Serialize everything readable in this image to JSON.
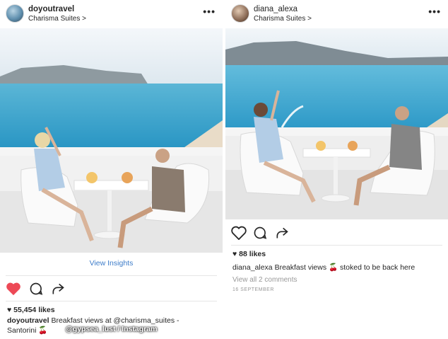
{
  "left_post": {
    "username": "doyoutravel",
    "location": "Charisma Suites",
    "location_chevron": ">",
    "more_icon": "•••",
    "insights_link": "View Insights",
    "likes": "55,454 likes",
    "caption_user": "doyoutravel",
    "caption_text": "Breakfast views at @charisma_suites -",
    "caption_line2": "Santorini 🍒",
    "liked": true,
    "like_color": "#ed4956"
  },
  "right_post": {
    "username": "diana_alexa",
    "location": "Charisma Suites",
    "location_chevron": ">",
    "more_icon": "•••",
    "likes": "88 likes",
    "caption_user": "diana_alexa",
    "caption_text": "Breakfast views 🍒 stoked to be back here",
    "comments_link": "View all 2 comments",
    "date": "16 SEPTEMBER",
    "liked": false
  },
  "credit": "@gypsea_lust / Instagram",
  "icons": [
    "heart-icon",
    "comment-icon",
    "share-icon",
    "more-icon",
    "heart-small-icon"
  ]
}
